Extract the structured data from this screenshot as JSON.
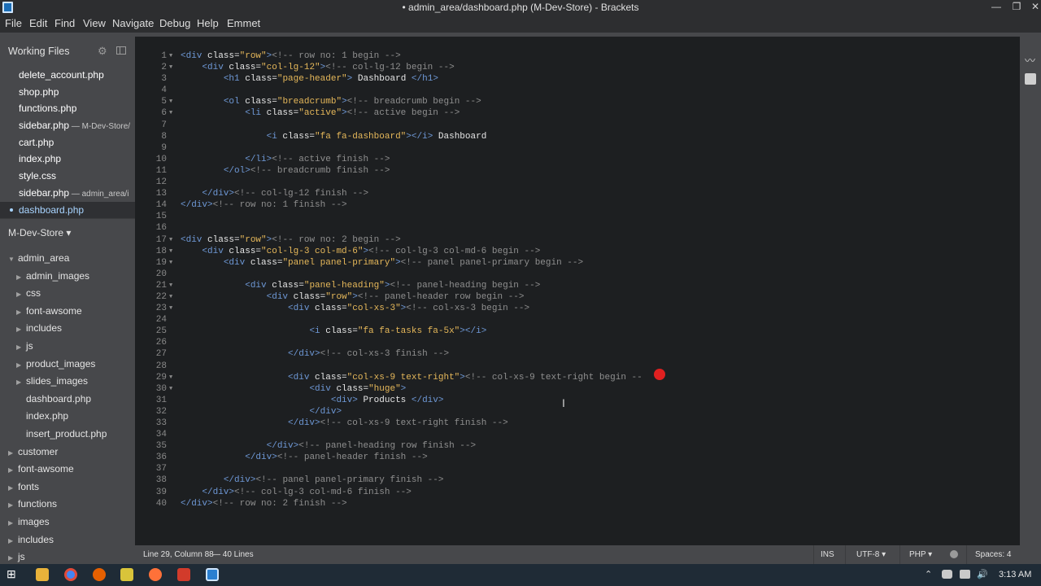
{
  "window": {
    "title": "• admin_area/dashboard.php (M-Dev-Store) - Brackets",
    "controls": {
      "minimize": "—",
      "restore": "❐",
      "close": "✕"
    }
  },
  "menu": [
    "File",
    "Edit",
    "Find",
    "View",
    "Navigate",
    "Debug",
    "Help",
    "Emmet"
  ],
  "sidebar": {
    "working_files_label": "Working Files",
    "working_files": [
      {
        "name": "delete_account.php",
        "dir": ""
      },
      {
        "name": "shop.php",
        "dir": ""
      },
      {
        "name": "functions.php",
        "dir": ""
      },
      {
        "name": "sidebar.php",
        "dir": " — M-Dev-Store/"
      },
      {
        "name": "cart.php",
        "dir": ""
      },
      {
        "name": "index.php",
        "dir": ""
      },
      {
        "name": "style.css",
        "dir": ""
      },
      {
        "name": "sidebar.php",
        "dir": " — admin_area/i"
      },
      {
        "name": "dashboard.php",
        "dir": "",
        "active": true
      }
    ],
    "project_title": "M-Dev-Store ▾",
    "tree": [
      {
        "label": "admin_area",
        "depth": 0,
        "arrow": "▼"
      },
      {
        "label": "admin_images",
        "depth": 1,
        "arrow": "▶"
      },
      {
        "label": "css",
        "depth": 1,
        "arrow": "▶"
      },
      {
        "label": "font-awsome",
        "depth": 1,
        "arrow": "▶"
      },
      {
        "label": "includes",
        "depth": 1,
        "arrow": "▶"
      },
      {
        "label": "js",
        "depth": 1,
        "arrow": "▶"
      },
      {
        "label": "product_images",
        "depth": 1,
        "arrow": "▶"
      },
      {
        "label": "slides_images",
        "depth": 1,
        "arrow": "▶"
      },
      {
        "label": "dashboard.php",
        "depth": 1,
        "arrow": ""
      },
      {
        "label": "index.php",
        "depth": 1,
        "arrow": ""
      },
      {
        "label": "insert_product.php",
        "depth": 1,
        "arrow": ""
      },
      {
        "label": "customer",
        "depth": 0,
        "arrow": "▶"
      },
      {
        "label": "font-awsome",
        "depth": 0,
        "arrow": "▶"
      },
      {
        "label": "fonts",
        "depth": 0,
        "arrow": "▶"
      },
      {
        "label": "functions",
        "depth": 0,
        "arrow": "▶"
      },
      {
        "label": "images",
        "depth": 0,
        "arrow": "▶"
      },
      {
        "label": "includes",
        "depth": 0,
        "arrow": "▶"
      },
      {
        "label": "js",
        "depth": 0,
        "arrow": "▶"
      }
    ]
  },
  "editor": {
    "lines": [
      {
        "n": 1,
        "f": "▼",
        "c": "<div class=\"row\"><!-- row no: 1 begin -->"
      },
      {
        "n": 2,
        "f": "▼",
        "c": "    <div class=\"col-lg-12\"><!-- col-lg-12 begin -->"
      },
      {
        "n": 3,
        "f": "",
        "c": "        <h1 class=\"page-header\"> Dashboard </h1>"
      },
      {
        "n": 4,
        "f": "",
        "c": ""
      },
      {
        "n": 5,
        "f": "▼",
        "c": "        <ol class=\"breadcrumb\"><!-- breadcrumb begin -->"
      },
      {
        "n": 6,
        "f": "▼",
        "c": "            <li class=\"active\"><!-- active begin -->"
      },
      {
        "n": 7,
        "f": "",
        "c": ""
      },
      {
        "n": 8,
        "f": "",
        "c": "                <i class=\"fa fa-dashboard\"></i> Dashboard"
      },
      {
        "n": 9,
        "f": "",
        "c": ""
      },
      {
        "n": 10,
        "f": "",
        "c": "            </li><!-- active finish -->"
      },
      {
        "n": 11,
        "f": "",
        "c": "        </ol><!-- breadcrumb finish -->"
      },
      {
        "n": 12,
        "f": "",
        "c": ""
      },
      {
        "n": 13,
        "f": "",
        "c": "    </div><!-- col-lg-12 finish -->"
      },
      {
        "n": 14,
        "f": "",
        "c": "</div><!-- row no: 1 finish -->"
      },
      {
        "n": 15,
        "f": "",
        "c": ""
      },
      {
        "n": 16,
        "f": "",
        "c": ""
      },
      {
        "n": 17,
        "f": "▼",
        "c": "<div class=\"row\"><!-- row no: 2 begin -->"
      },
      {
        "n": 18,
        "f": "▼",
        "c": "    <div class=\"col-lg-3 col-md-6\"><!-- col-lg-3 col-md-6 begin -->"
      },
      {
        "n": 19,
        "f": "▼",
        "c": "        <div class=\"panel panel-primary\"><!-- panel panel-primary begin -->"
      },
      {
        "n": 20,
        "f": "",
        "c": ""
      },
      {
        "n": 21,
        "f": "▼",
        "c": "            <div class=\"panel-heading\"><!-- panel-heading begin -->"
      },
      {
        "n": 22,
        "f": "▼",
        "c": "                <div class=\"row\"><!-- panel-header row begin -->"
      },
      {
        "n": 23,
        "f": "▼",
        "c": "                    <div class=\"col-xs-3\"><!-- col-xs-3 begin -->"
      },
      {
        "n": 24,
        "f": "",
        "c": ""
      },
      {
        "n": 25,
        "f": "",
        "c": "                        <i class=\"fa fa-tasks fa-5x\"></i>"
      },
      {
        "n": 26,
        "f": "",
        "c": ""
      },
      {
        "n": 27,
        "f": "",
        "c": "                    </div><!-- col-xs-3 finish -->"
      },
      {
        "n": 28,
        "f": "",
        "c": ""
      },
      {
        "n": 29,
        "f": "▼",
        "c": "                    <div class=\"col-xs-9 text-right\"><!-- col-xs-9 text-right begin --"
      },
      {
        "n": 30,
        "f": "▼",
        "c": "                        <div class=\"huge\">"
      },
      {
        "n": 31,
        "f": "",
        "c": "                            <div> Products </div>"
      },
      {
        "n": 32,
        "f": "",
        "c": "                        </div>"
      },
      {
        "n": 33,
        "f": "",
        "c": "                    </div><!-- col-xs-9 text-right finish -->"
      },
      {
        "n": 34,
        "f": "",
        "c": ""
      },
      {
        "n": 35,
        "f": "",
        "c": "                </div><!-- panel-heading row finish -->"
      },
      {
        "n": 36,
        "f": "",
        "c": "            </div><!-- panel-header finish -->"
      },
      {
        "n": 37,
        "f": "",
        "c": ""
      },
      {
        "n": 38,
        "f": "",
        "c": "        </div><!-- panel panel-primary finish -->"
      },
      {
        "n": 39,
        "f": "",
        "c": "    </div><!-- col-lg-3 col-md-6 finish -->"
      },
      {
        "n": 40,
        "f": "",
        "c": "</div><!-- row no: 2 finish -->"
      }
    ]
  },
  "status": {
    "cursor": "Line 29, Column 88",
    "lines": "— 40 Lines",
    "mode": "INS",
    "encoding": "UTF-8 ▾",
    "language": "PHP ▾",
    "spaces": "Spaces: 4"
  },
  "taskbar": {
    "clock": "3:13 AM",
    "tray": {
      "chevron": "⌃",
      "volume": "🔊"
    }
  },
  "colors": {
    "tag": "#6e98d6",
    "string": "#e6b85a",
    "comment": "#8f8f8f",
    "sidebar": "#47484b",
    "editor_bg": "#1d1f21",
    "active_file": "#8fc8ff"
  }
}
